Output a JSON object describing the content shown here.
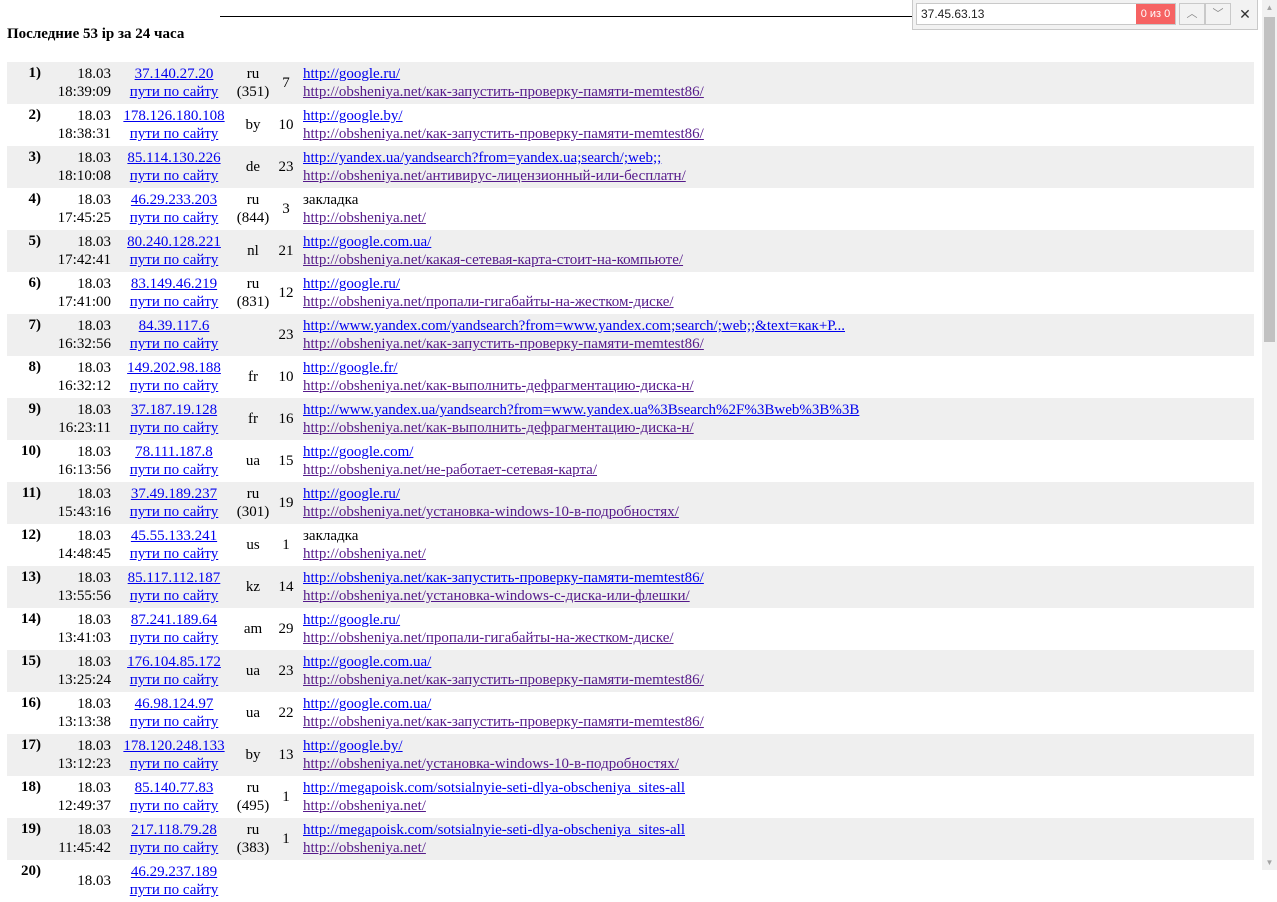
{
  "heading": "Последние 53 ip за 24 часа",
  "find_bar": {
    "query": "37.45.63.13",
    "match_count": "0 из 0",
    "prev_icon": "chevron-up-icon",
    "next_icon": "chevron-down-icon",
    "close_icon": "close-icon",
    "prev_symbol": "︿",
    "next_symbol": "﹀",
    "close_symbol": "✕",
    "count_color": "#f66363"
  },
  "paths_label": "пути по сайту",
  "rows": [
    {
      "num": "1)",
      "date": "18.03",
      "time": "18:39:09",
      "ip": "37.140.27.20",
      "country": "ru",
      "country_extra": "(351)",
      "hits": "7",
      "ref1": "http://google.ru/",
      "ref2": "http://obsheniya.net/как-запустить-проверку-памяти-memtest86/"
    },
    {
      "num": "2)",
      "date": "18.03",
      "time": "18:38:31",
      "ip": "178.126.180.108",
      "country": "by",
      "country_extra": "",
      "hits": "10",
      "ref1": "http://google.by/",
      "ref2": "http://obsheniya.net/как-запустить-проверку-памяти-memtest86/"
    },
    {
      "num": "3)",
      "date": "18.03",
      "time": "18:10:08",
      "ip": "85.114.130.226",
      "country": "de",
      "country_extra": "",
      "hits": "23",
      "ref1": "http://yandex.ua/yandsearch?from=yandex.ua;search/;web;;",
      "ref2": "http://obsheniya.net/антивирус-лицензионный-или-бесплатн/"
    },
    {
      "num": "4)",
      "date": "18.03",
      "time": "17:45:25",
      "ip": "46.29.233.203",
      "country": "ru",
      "country_extra": "(844)",
      "hits": "3",
      "ref1": "закладка",
      "ref2": "http://obsheniya.net/"
    },
    {
      "num": "5)",
      "date": "18.03",
      "time": "17:42:41",
      "ip": "80.240.128.221",
      "country": "nl",
      "country_extra": "",
      "hits": "21",
      "ref1": "http://google.com.ua/",
      "ref2": "http://obsheniya.net/какая-сетевая-карта-стоит-на-компьюте/"
    },
    {
      "num": "6)",
      "date": "18.03",
      "time": "17:41:00",
      "ip": "83.149.46.219",
      "country": "ru",
      "country_extra": "(831)",
      "hits": "12",
      "ref1": "http://google.ru/",
      "ref2": "http://obsheniya.net/пропали-гигабайты-на-жестком-диске/"
    },
    {
      "num": "7)",
      "date": "18.03",
      "time": "16:32:56",
      "ip": "84.39.117.6",
      "country": "",
      "country_extra": "",
      "hits": "23",
      "ref1": "http://www.yandex.com/yandsearch?from=www.yandex.com;search/;web;;&text=как+Р...",
      "ref2": "http://obsheniya.net/как-запустить-проверку-памяти-memtest86/"
    },
    {
      "num": "8)",
      "date": "18.03",
      "time": "16:32:12",
      "ip": "149.202.98.188",
      "country": "fr",
      "country_extra": "",
      "hits": "10",
      "ref1": "http://google.fr/",
      "ref2": "http://obsheniya.net/как-выполнить-дефрагментацию-диска-н/"
    },
    {
      "num": "9)",
      "date": "18.03",
      "time": "16:23:11",
      "ip": "37.187.19.128",
      "country": "fr",
      "country_extra": "",
      "hits": "16",
      "ref1": "http://www.yandex.ua/yandsearch?from=www.yandex.ua%3Bsearch%2F%3Bweb%3B%3B",
      "ref2": "http://obsheniya.net/как-выполнить-дефрагментацию-диска-н/"
    },
    {
      "num": "10)",
      "date": "18.03",
      "time": "16:13:56",
      "ip": "78.111.187.8",
      "country": "ua",
      "country_extra": "",
      "hits": "15",
      "ref1": "http://google.com/",
      "ref2": "http://obsheniya.net/не-работает-сетевая-карта/"
    },
    {
      "num": "11)",
      "date": "18.03",
      "time": "15:43:16",
      "ip": "37.49.189.237",
      "country": "ru",
      "country_extra": "(301)",
      "hits": "19",
      "ref1": "http://google.ru/",
      "ref2": "http://obsheniya.net/установка-windows-10-в-подробностях/"
    },
    {
      "num": "12)",
      "date": "18.03",
      "time": "14:48:45",
      "ip": "45.55.133.241",
      "country": "us",
      "country_extra": "",
      "hits": "1",
      "ref1": "закладка",
      "ref2": "http://obsheniya.net/"
    },
    {
      "num": "13)",
      "date": "18.03",
      "time": "13:55:56",
      "ip": "85.117.112.187",
      "country": "kz",
      "country_extra": "",
      "hits": "14",
      "ref1": "http://obsheniya.net/как-запустить-проверку-памяти-memtest86/",
      "ref2": "http://obsheniya.net/установка-windows-с-диска-или-флешки/"
    },
    {
      "num": "14)",
      "date": "18.03",
      "time": "13:41:03",
      "ip": "87.241.189.64",
      "country": "am",
      "country_extra": "",
      "hits": "29",
      "ref1": "http://google.ru/",
      "ref2": "http://obsheniya.net/пропали-гигабайты-на-жестком-диске/"
    },
    {
      "num": "15)",
      "date": "18.03",
      "time": "13:25:24",
      "ip": "176.104.85.172",
      "country": "ua",
      "country_extra": "",
      "hits": "23",
      "ref1": "http://google.com.ua/",
      "ref2": "http://obsheniya.net/как-запустить-проверку-памяти-memtest86/"
    },
    {
      "num": "16)",
      "date": "18.03",
      "time": "13:13:38",
      "ip": "46.98.124.97",
      "country": "ua",
      "country_extra": "",
      "hits": "22",
      "ref1": "http://google.com.ua/",
      "ref2": "http://obsheniya.net/как-запустить-проверку-памяти-memtest86/"
    },
    {
      "num": "17)",
      "date": "18.03",
      "time": "13:12:23",
      "ip": "178.120.248.133",
      "country": "by",
      "country_extra": "",
      "hits": "13",
      "ref1": "http://google.by/",
      "ref2": "http://obsheniya.net/установка-windows-10-в-подробностях/"
    },
    {
      "num": "18)",
      "date": "18.03",
      "time": "12:49:37",
      "ip": "85.140.77.83",
      "country": "ru",
      "country_extra": "(495)",
      "hits": "1",
      "ref1": "http://megapoisk.com/sotsialnyie-seti-dlya-obscheniya_sites-all",
      "ref2": "http://obsheniya.net/"
    },
    {
      "num": "19)",
      "date": "18.03",
      "time": "11:45:42",
      "ip": "217.118.79.28",
      "country": "ru",
      "country_extra": "(383)",
      "hits": "1",
      "ref1": "http://megapoisk.com/sotsialnyie-seti-dlya-obscheniya_sites-all",
      "ref2": "http://obsheniya.net/"
    },
    {
      "num": "20)",
      "date": "18.03",
      "time": "",
      "ip": "46.29.237.189",
      "country": "",
      "country_extra": "",
      "hits": "",
      "ref1": "",
      "ref2": ""
    }
  ]
}
